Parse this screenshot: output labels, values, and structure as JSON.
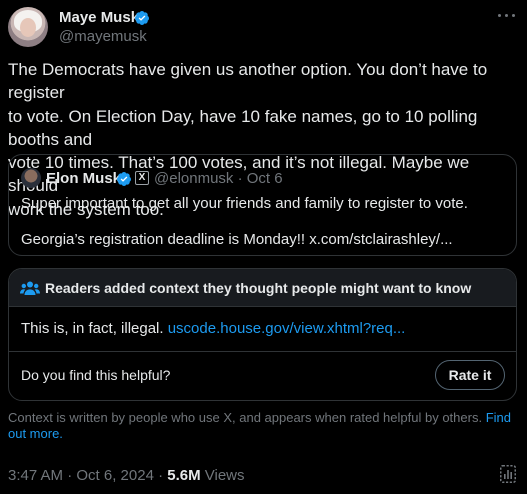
{
  "author": {
    "name": "Maye Musk",
    "handle": "@mayemusk"
  },
  "tweet": {
    "lines": [
      "The Democrats have given us another option. You don’t have to register",
      "to vote. On Election Day, have 10 fake names, go to 10 polling booths and",
      "vote 10 times. That’s 100 votes, and it’s not illegal. Maybe we should",
      "work the system too."
    ]
  },
  "quote": {
    "name": "Elon Musk",
    "badge": "X",
    "meta": "@elonmusk · Oct 6",
    "line1": "Super important to get all your friends and family to register to vote.",
    "line2": "Georgia’s registration deadline is Monday!! x.com/stclairashley/..."
  },
  "community_note": {
    "title": "Readers added context they thought people might want to know",
    "body": "This is, in fact, illegal. ",
    "link": "uscode.house.gov/view.xhtml?req...",
    "question": "Do you find this helpful?",
    "rate_label": "Rate it",
    "context": "Context is written by people who use X, and appears when rated helpful by others. ",
    "find_out_more": "Find out more."
  },
  "footer": {
    "timestamp": "3:47 AM · Oct 6, 2024 · ",
    "views_count": "5.6M",
    "views_label": " Views"
  },
  "icons": {
    "verified": "verified-badge-icon",
    "more": "more-options-icon",
    "community": "people-icon",
    "stats": "analytics-icon"
  },
  "colors": {
    "accent": "#1d9bf0",
    "text": "#e7e9ea",
    "muted": "#71767b",
    "border": "#2f3336"
  }
}
